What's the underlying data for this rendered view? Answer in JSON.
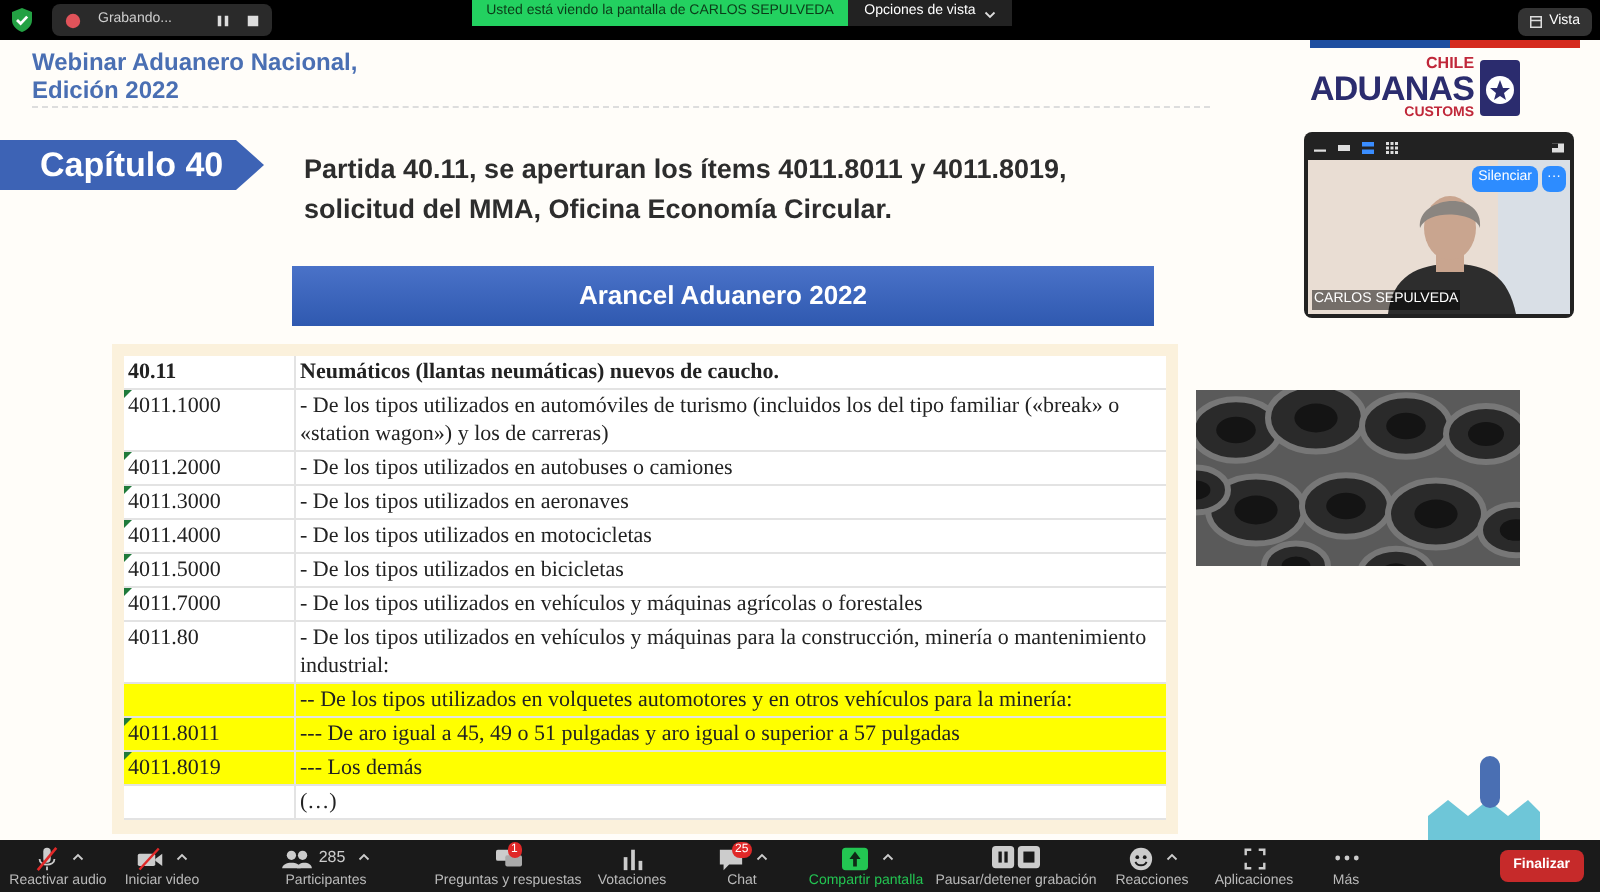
{
  "top_bar": {
    "recording": "Grabando...",
    "sharing_banner": "Usted está viendo la pantalla de CARLOS SEPULVEDA",
    "view_options": "Opciones de vista",
    "view_button": "Vista"
  },
  "slide": {
    "event_title": [
      "Webinar Aduanero Nacional,",
      "Edición 2022"
    ],
    "logo": {
      "top": "CHILE",
      "main": "ADUANAS",
      "bottom": "CUSTOMS"
    },
    "chapter": "Capítulo 40",
    "heading": [
      "Partida 40.11, se aperturan los ítems 4011.8011 y 4011.8019,",
      "solicitud del MMA, Oficina Economía Circular."
    ],
    "banner": "Arancel Aduanero 2022",
    "table": {
      "rows": [
        {
          "kind": "header",
          "code": "40.11",
          "description": "Neumáticos (llantas neumáticas) nuevos de caucho.",
          "highlighted": false,
          "marker": false
        },
        {
          "kind": "item",
          "code": "4011.1000",
          "description": "- De los tipos utilizados en automóviles de turismo (incluidos los del tipo familiar («break» o «station wagon») y los de carreras)",
          "highlighted": false,
          "marker": true
        },
        {
          "kind": "item",
          "code": "4011.2000",
          "description": "- De los tipos utilizados en autobuses o camiones",
          "highlighted": false,
          "marker": true
        },
        {
          "kind": "item",
          "code": "4011.3000",
          "description": "- De los tipos utilizados en aeronaves",
          "highlighted": false,
          "marker": true
        },
        {
          "kind": "item",
          "code": "4011.4000",
          "description": "- De los tipos utilizados en motocicletas",
          "highlighted": false,
          "marker": true
        },
        {
          "kind": "item",
          "code": "4011.5000",
          "description": "- De los tipos utilizados en bicicletas",
          "highlighted": false,
          "marker": true
        },
        {
          "kind": "item",
          "code": "4011.7000",
          "description": "- De los tipos utilizados en vehículos y máquinas agrícolas o forestales",
          "highlighted": false,
          "marker": true
        },
        {
          "kind": "item",
          "code": "4011.80",
          "description": "- De los tipos utilizados en vehículos y máquinas para la construcción, minería o mantenimiento industrial:",
          "highlighted": false,
          "marker": false
        },
        {
          "kind": "item",
          "description": "-- De los tipos utilizados en volquetes automotores y en otros vehículos para la minería:",
          "highlighted": true,
          "marker": false
        },
        {
          "kind": "item",
          "code": "4011.8011",
          "description": "--- De aro igual a 45, 49 o 51 pulgadas y aro igual o superior a 57 pulgadas",
          "highlighted": true,
          "marker": true
        },
        {
          "kind": "item",
          "code": "4011.8019",
          "description": "--- Los demás",
          "highlighted": true,
          "marker": true
        },
        {
          "kind": "item",
          "description": "(…)",
          "highlighted": false,
          "marker": false
        }
      ]
    }
  },
  "video_tile": {
    "name": "CARLOS SEPULVEDA",
    "mute_button": "Silenciar",
    "more_button": "···"
  },
  "toolbar": {
    "items": [
      {
        "kind": "mic",
        "label": "Reactivar audio",
        "menu": true
      },
      {
        "kind": "camera",
        "label": "Iniciar video",
        "menu": true
      },
      {
        "kind": "people",
        "label": "Participantes",
        "count": "285",
        "menu": true
      },
      {
        "kind": "qa",
        "label": "Preguntas y respuestas",
        "badge": "1",
        "menu": false
      },
      {
        "kind": "poll",
        "label": "Votaciones",
        "menu": false
      },
      {
        "kind": "chat",
        "label": "Chat",
        "badge": "25",
        "menu": true
      },
      {
        "kind": "share",
        "label": "Compartir pantalla",
        "menu": true
      },
      {
        "kind": "record",
        "label": "Pausar/detener grabación",
        "menu": false
      },
      {
        "kind": "reactions",
        "label": "Reacciones",
        "menu": true
      },
      {
        "kind": "apps",
        "label": "Aplicaciones",
        "menu": false
      },
      {
        "kind": "more",
        "label": "Más",
        "menu": false
      }
    ],
    "end_button": "Finalizar"
  }
}
